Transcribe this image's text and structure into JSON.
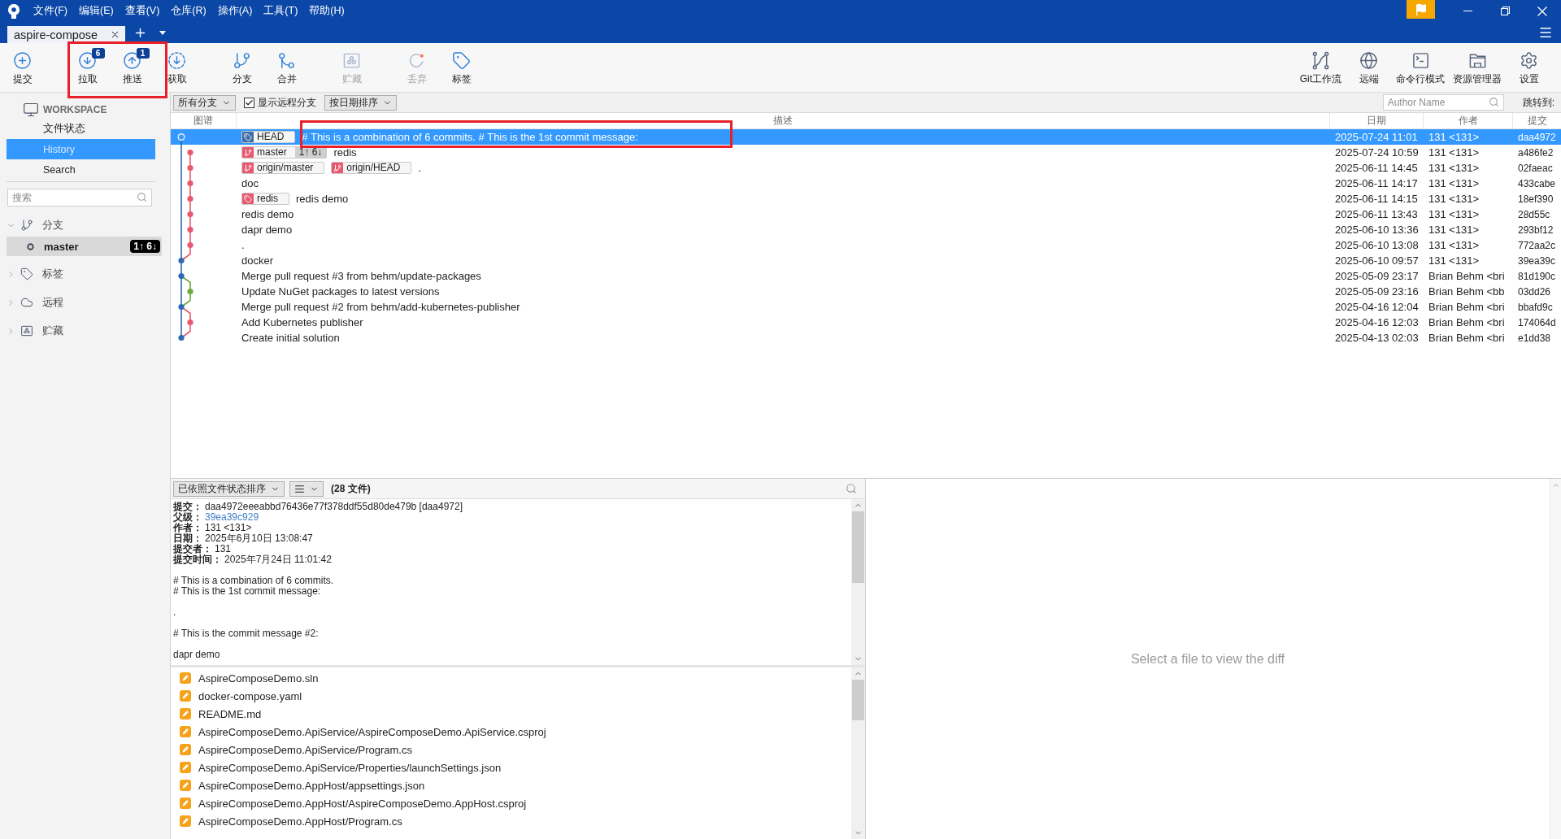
{
  "window": {
    "menus": [
      "文件(F)",
      "编辑(E)",
      "查看(V)",
      "仓库(R)",
      "操作(A)",
      "工具(T)",
      "帮助(H)"
    ],
    "tabs": [
      {
        "label": "aspire-compose",
        "selected": true
      }
    ]
  },
  "toolbar": {
    "left_groups": [
      {
        "buttons": [
          {
            "kind": "commit",
            "label": "提交",
            "disabled": false,
            "highlighted": false
          }
        ]
      },
      {
        "buttons": [
          {
            "kind": "pull",
            "label": "拉取",
            "badge": "6",
            "disabled": false,
            "highlighted": true
          },
          {
            "kind": "push",
            "label": "推送",
            "badge": "1",
            "disabled": false,
            "highlighted": true
          },
          {
            "kind": "fetch",
            "label": "获取",
            "disabled": false,
            "highlighted": false
          }
        ]
      },
      {
        "buttons": [
          {
            "kind": "branch",
            "label": "分支",
            "disabled": false,
            "highlighted": false
          },
          {
            "kind": "merge",
            "label": "合并",
            "disabled": false,
            "highlighted": false
          }
        ]
      },
      {
        "buttons": [
          {
            "kind": "stash",
            "label": "贮藏",
            "disabled": true,
            "highlighted": false
          }
        ]
      },
      {
        "buttons": [
          {
            "kind": "discard",
            "label": "丢弃",
            "disabled": true,
            "highlighted": false
          },
          {
            "kind": "tag",
            "label": "标签",
            "disabled": false,
            "highlighted": false
          }
        ]
      }
    ],
    "right": [
      {
        "kind": "gitflow",
        "label": "Git工作流",
        "disabled": false,
        "highlighted": false
      },
      {
        "kind": "remote",
        "label": "远端",
        "disabled": false,
        "highlighted": false
      },
      {
        "kind": "terminal",
        "label": "命令行模式",
        "disabled": false,
        "highlighted": false
      },
      {
        "kind": "explorer",
        "label": "资源管理器",
        "disabled": false,
        "highlighted": false
      },
      {
        "kind": "settings",
        "label": "设置",
        "disabled": false,
        "highlighted": false
      }
    ]
  },
  "sidebar": {
    "workspace": {
      "title": "WORKSPACE",
      "items": [
        {
          "label": "文件状态",
          "selected": false
        },
        {
          "label": "History",
          "selected": true
        },
        {
          "label": "Search",
          "selected": false
        }
      ]
    },
    "search": {
      "placeholder": "搜索"
    },
    "sections": [
      {
        "kind": "branches",
        "label": "分支",
        "expanded": true,
        "children": [
          {
            "label": "master",
            "current": true,
            "selected": true,
            "badge": "1↑ 6↓"
          }
        ]
      },
      {
        "kind": "tags",
        "label": "标签",
        "expanded": false
      },
      {
        "kind": "remotes",
        "label": "远程",
        "expanded": false
      },
      {
        "kind": "stashes",
        "label": "贮藏",
        "expanded": false
      }
    ]
  },
  "filter_bar": {
    "branch_filter": "所有分支",
    "show_remote": {
      "label": "显示远程分支",
      "checked": true
    },
    "sort": "按日期排序",
    "author_search": {
      "placeholder": "Author Name"
    },
    "jump_label": "跳转到:"
  },
  "history": {
    "columns": [
      "图谱",
      "描述",
      "日期",
      "作者",
      "提交"
    ],
    "commits": [
      {
        "node": {
          "kind": "current",
          "color": "#e9f1fb"
        },
        "refs": [
          {
            "kind": "tag",
            "name": "HEAD",
            "color": "#3d6ea6"
          }
        ],
        "message": "# This is a combination of 6 commits. # This is the 1st commit message:",
        "date": "2025-07-24 11:01",
        "author": "131 <131>",
        "hash": "daa4972",
        "selected": true,
        "highlighted": true
      },
      {
        "node": {
          "kind": "tip",
          "color": "#e8586e"
        },
        "refs": [
          {
            "kind": "branch",
            "name": "master",
            "color": "#e8586e",
            "ahead_behind": "1↑ 6↓"
          }
        ],
        "message": "redis",
        "date": "2025-07-24 10:59",
        "author": "131 <131>",
        "hash": "a486fe2",
        "selected": false,
        "highlighted": false
      },
      {
        "node": {
          "kind": "branch",
          "color": "#e8586e"
        },
        "refs": [
          {
            "kind": "branch",
            "name": "origin/master",
            "color": "#e8586e"
          },
          {
            "kind": "branch",
            "name": "origin/HEAD",
            "color": "#e8586e"
          }
        ],
        "message": ".",
        "date": "2025-06-11 14:45",
        "author": "131 <131>",
        "hash": "02faeac",
        "selected": false,
        "highlighted": false
      },
      {
        "node": {
          "kind": "branch",
          "color": "#e8586e"
        },
        "message": "doc",
        "date": "2025-06-11 14:17",
        "author": "131 <131>",
        "hash": "433cabe",
        "selected": false,
        "highlighted": false
      },
      {
        "node": {
          "kind": "branch",
          "color": "#e8586e"
        },
        "refs": [
          {
            "kind": "tag",
            "name": "redis",
            "color": "#e8586e"
          }
        ],
        "message": "redis demo",
        "date": "2025-06-11 14:15",
        "author": "131 <131>",
        "hash": "18ef390",
        "selected": false,
        "highlighted": false
      },
      {
        "node": {
          "kind": "branch",
          "color": "#e8586e"
        },
        "message": "redis demo",
        "date": "2025-06-11 13:43",
        "author": "131 <131>",
        "hash": "28d55c",
        "selected": false,
        "highlighted": false
      },
      {
        "node": {
          "kind": "branch",
          "color": "#e8586e"
        },
        "message": "dapr demo",
        "date": "2025-06-10 13:36",
        "author": "131 <131>",
        "hash": "293bf12",
        "selected": false,
        "highlighted": false
      },
      {
        "node": {
          "kind": "branch",
          "color": "#e8586e"
        },
        "message": ".",
        "date": "2025-06-10 13:08",
        "author": "131 <131>",
        "hash": "772aa2c",
        "selected": false,
        "highlighted": false
      },
      {
        "node": {
          "kind": "main",
          "color": "#2f69b3"
        },
        "message": "docker",
        "date": "2025-06-10 09:57",
        "author": "131 <131>",
        "hash": "39ea39c",
        "selected": false,
        "highlighted": false
      },
      {
        "node": {
          "kind": "main",
          "color": "#2f69b3"
        },
        "message": "Merge pull request #3 from behm/update-packages",
        "date": "2025-05-09 23:17",
        "author": "Brian Behm <bri",
        "hash": "81d190c",
        "selected": false,
        "highlighted": false
      },
      {
        "node": {
          "kind": "branch",
          "color": "#6aab3c"
        },
        "message": "Update NuGet packages to latest versions",
        "date": "2025-05-09 23:16",
        "author": "Brian Behm <bb",
        "hash": "03dd26",
        "selected": false,
        "highlighted": false
      },
      {
        "node": {
          "kind": "main",
          "color": "#2f69b3"
        },
        "message": "Merge pull request #2 from behm/add-kubernetes-publisher",
        "date": "2025-04-16 12:04",
        "author": "Brian Behm <bri",
        "hash": "bbafd9c",
        "selected": false,
        "highlighted": false
      },
      {
        "node": {
          "kind": "branch",
          "color": "#e8586e"
        },
        "message": "Add Kubernetes publisher",
        "date": "2025-04-16 12:03",
        "author": "Brian Behm <bri",
        "hash": "174064d",
        "selected": false,
        "highlighted": false
      },
      {
        "node": {
          "kind": "main",
          "color": "#2f69b3"
        },
        "message": "Create initial solution",
        "date": "2025-04-13 02:03",
        "author": "Brian Behm <bri",
        "hash": "e1dd38",
        "selected": false,
        "highlighted": false
      }
    ]
  },
  "commit_details": {
    "toolbar": {
      "sort": "已依照文件状态排序",
      "file_count": "(28 文件)"
    },
    "fields": [
      {
        "kind": "text",
        "label": "提交：",
        "value": "daa4972eeeabbd76436e77f378ddf55d80de479b [daa4972]"
      },
      {
        "kind": "link",
        "label": "父级：",
        "value": "39ea39c929"
      },
      {
        "kind": "text",
        "label": "作者：",
        "value": "131 <131>"
      },
      {
        "kind": "text",
        "label": "日期：",
        "value": "2025年6月10日 13:08:47"
      },
      {
        "kind": "text",
        "label": "提交者：",
        "value": "131"
      },
      {
        "kind": "text",
        "label": "提交时间：",
        "value": "2025年7月24日 11:01:42"
      }
    ],
    "message_paragraphs": [
      [
        "# This is a combination of 6 commits.",
        "# This is the 1st commit message:"
      ],
      [
        "."
      ],
      [
        "# This is the commit message #2:"
      ],
      [
        "dapr demo"
      ]
    ],
    "files": [
      {
        "path": "AspireComposeDemo.sln",
        "kind": "modified"
      },
      {
        "path": "docker-compose.yaml",
        "kind": "modified"
      },
      {
        "path": "README.md",
        "kind": "modified"
      },
      {
        "path": "AspireComposeDemo.ApiService/AspireComposeDemo.ApiService.csproj",
        "kind": "modified"
      },
      {
        "path": "AspireComposeDemo.ApiService/Program.cs",
        "kind": "modified"
      },
      {
        "path": "AspireComposeDemo.ApiService/Properties/launchSettings.json",
        "kind": "modified"
      },
      {
        "path": "AspireComposeDemo.AppHost/appsettings.json",
        "kind": "modified"
      },
      {
        "path": "AspireComposeDemo.AppHost/AspireComposeDemo.AppHost.csproj",
        "kind": "modified"
      },
      {
        "path": "AspireComposeDemo.AppHost/Program.cs",
        "kind": "modified"
      }
    ]
  },
  "diff": {
    "message": "Select a file to view the diff"
  }
}
